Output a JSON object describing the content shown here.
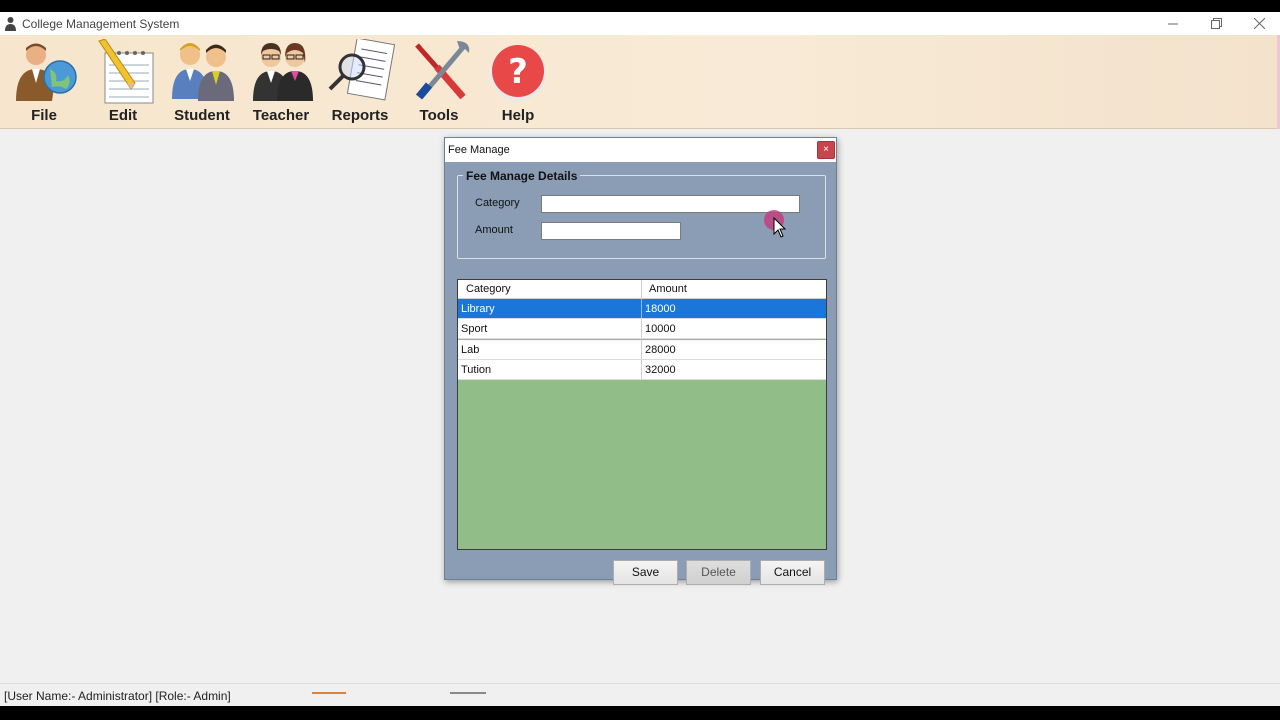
{
  "app": {
    "title": "College Management System"
  },
  "toolbar": {
    "items": [
      {
        "label": "File",
        "icon": "person-globe-icon"
      },
      {
        "label": "Edit",
        "icon": "notepad-pencil-icon"
      },
      {
        "label": "Student",
        "icon": "students-icon"
      },
      {
        "label": "Teacher",
        "icon": "teachers-icon"
      },
      {
        "label": "Reports",
        "icon": "report-magnifier-icon"
      },
      {
        "label": "Tools",
        "icon": "wrench-screwdriver-icon"
      },
      {
        "label": "Help",
        "icon": "question-icon"
      }
    ]
  },
  "dialog": {
    "title": "Fee Manage",
    "close": "×",
    "group": {
      "legend": "Fee Manage Details",
      "category_label": "Category",
      "category_value": "",
      "amount_label": "Amount",
      "amount_value": ""
    },
    "grid": {
      "columns": [
        "Category",
        "Amount"
      ],
      "rows": [
        {
          "category": "Library",
          "amount": "18000",
          "selected": true
        },
        {
          "category": "Sport",
          "amount": "10000",
          "selected": false
        },
        {
          "category": "Lab",
          "amount": "28000",
          "selected": false
        },
        {
          "category": "Tution",
          "amount": "32000",
          "selected": false
        }
      ]
    },
    "buttons": {
      "save": "Save",
      "delete": "Delete",
      "cancel": "Cancel"
    }
  },
  "status": {
    "text": "[User Name:- Administrator]  [Role:- Admin]"
  },
  "colors": {
    "toolbar_bg": "#f7e6cd",
    "dialog_bg": "#8a9db5",
    "grid_empty_bg": "#90bd88",
    "selection": "#1a76d8",
    "close_button": "#c7464d"
  }
}
